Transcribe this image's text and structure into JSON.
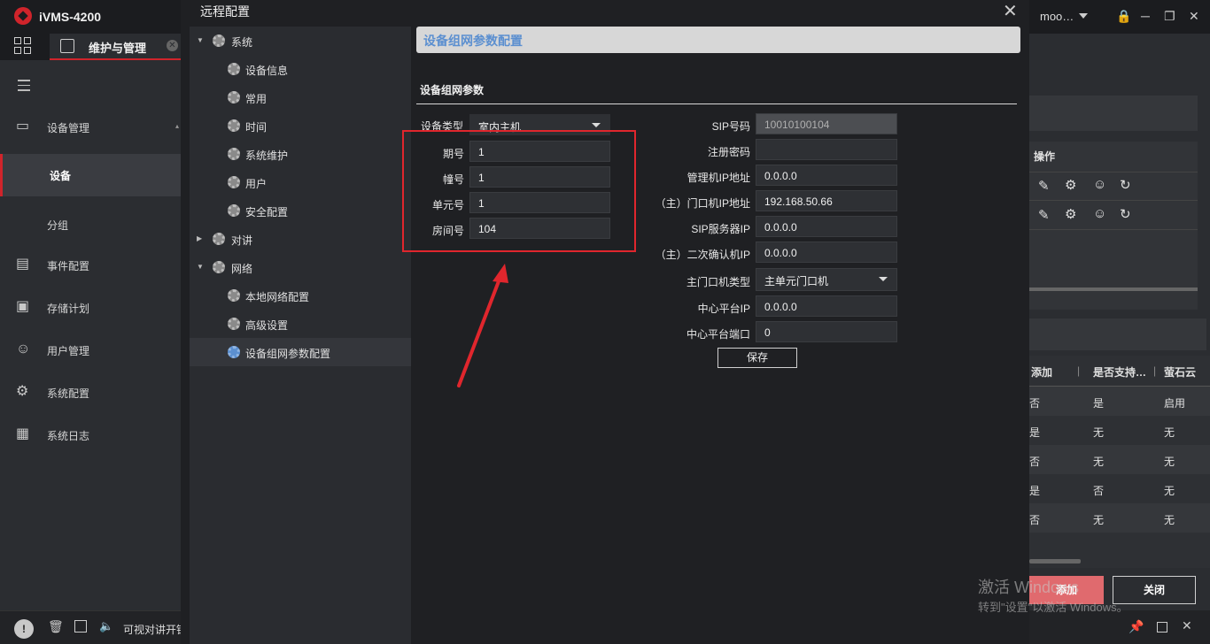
{
  "app": {
    "title": "iVMS-4200",
    "user": "moo…"
  },
  "tab": {
    "label": "维护与管理"
  },
  "nav": {
    "items": [
      {
        "label": "设备管理",
        "icon": "device-manage-icon"
      },
      {
        "label": "设备",
        "icon": ""
      },
      {
        "label": "分组",
        "icon": ""
      },
      {
        "label": "事件配置",
        "icon": "event-icon"
      },
      {
        "label": "存储计划",
        "icon": "storage-icon"
      },
      {
        "label": "用户管理",
        "icon": "user-icon"
      },
      {
        "label": "系统配置",
        "icon": "gear-icon"
      },
      {
        "label": "系统日志",
        "icon": "log-icon"
      }
    ]
  },
  "statusbar": {
    "text": "可视对讲开锁"
  },
  "dialog": {
    "title": "远程配置",
    "tree": [
      {
        "label": "系统",
        "level": 0,
        "expanded": true
      },
      {
        "label": "设备信息",
        "level": 1
      },
      {
        "label": "常用",
        "level": 1
      },
      {
        "label": "时间",
        "level": 1
      },
      {
        "label": "系统维护",
        "level": 1
      },
      {
        "label": "用户",
        "level": 1
      },
      {
        "label": "安全配置",
        "level": 1
      },
      {
        "label": "对讲",
        "level": 0,
        "expanded": false
      },
      {
        "label": "网络",
        "level": 0,
        "expanded": true
      },
      {
        "label": "本地网络配置",
        "level": 1
      },
      {
        "label": "高级设置",
        "level": 1
      },
      {
        "label": "设备组网参数配置",
        "level": 1,
        "selected": true
      }
    ],
    "header": "设备组网参数配置",
    "section_title": "设备组网参数",
    "left_fields": {
      "device_type": {
        "label": "设备类型",
        "value": "室内主机"
      },
      "period": {
        "label": "期号",
        "value": "1"
      },
      "building": {
        "label": "幢号",
        "value": "1"
      },
      "unit": {
        "label": "单元号",
        "value": "1"
      },
      "room": {
        "label": "房间号",
        "value": "104"
      }
    },
    "right_fields": {
      "sip": {
        "label": "SIP号码",
        "value": "10010100104"
      },
      "reg_pwd": {
        "label": "注册密码",
        "value": ""
      },
      "mgr_ip": {
        "label": "管理机IP地址",
        "value": "0.0.0.0"
      },
      "door_ip": {
        "label": "（主）门口机IP地址",
        "value": "192.168.50.66"
      },
      "sip_server": {
        "label": "SIP服务器IP",
        "value": "0.0.0.0"
      },
      "confirm_ip": {
        "label": "（主）二次确认机IP",
        "value": "0.0.0.0"
      },
      "door_type": {
        "label": "主门口机类型",
        "value": "主单元门口机"
      },
      "center_ip": {
        "label": "中心平台IP",
        "value": "0.0.0.0"
      },
      "center_port": {
        "label": "中心平台端口",
        "value": "0"
      }
    },
    "save_label": "保存"
  },
  "right": {
    "ops_header": "操作",
    "table_headers": [
      "添加",
      "是否支持…",
      "萤石云"
    ],
    "rows": [
      [
        "否",
        "是",
        "启用"
      ],
      [
        "是",
        "无",
        "无"
      ],
      [
        "否",
        "无",
        "无"
      ],
      [
        "是",
        "否",
        "无"
      ],
      [
        "否",
        "无",
        "无"
      ]
    ],
    "add_label": "添加",
    "close_label": "关闭"
  },
  "watermark": {
    "line1": "激活 Windows",
    "line2": "转到\"设置\"以激活 Windows。"
  },
  "colors": {
    "accent": "#d0242b",
    "highlight": "#e0262d",
    "link": "#5b8fd0"
  }
}
